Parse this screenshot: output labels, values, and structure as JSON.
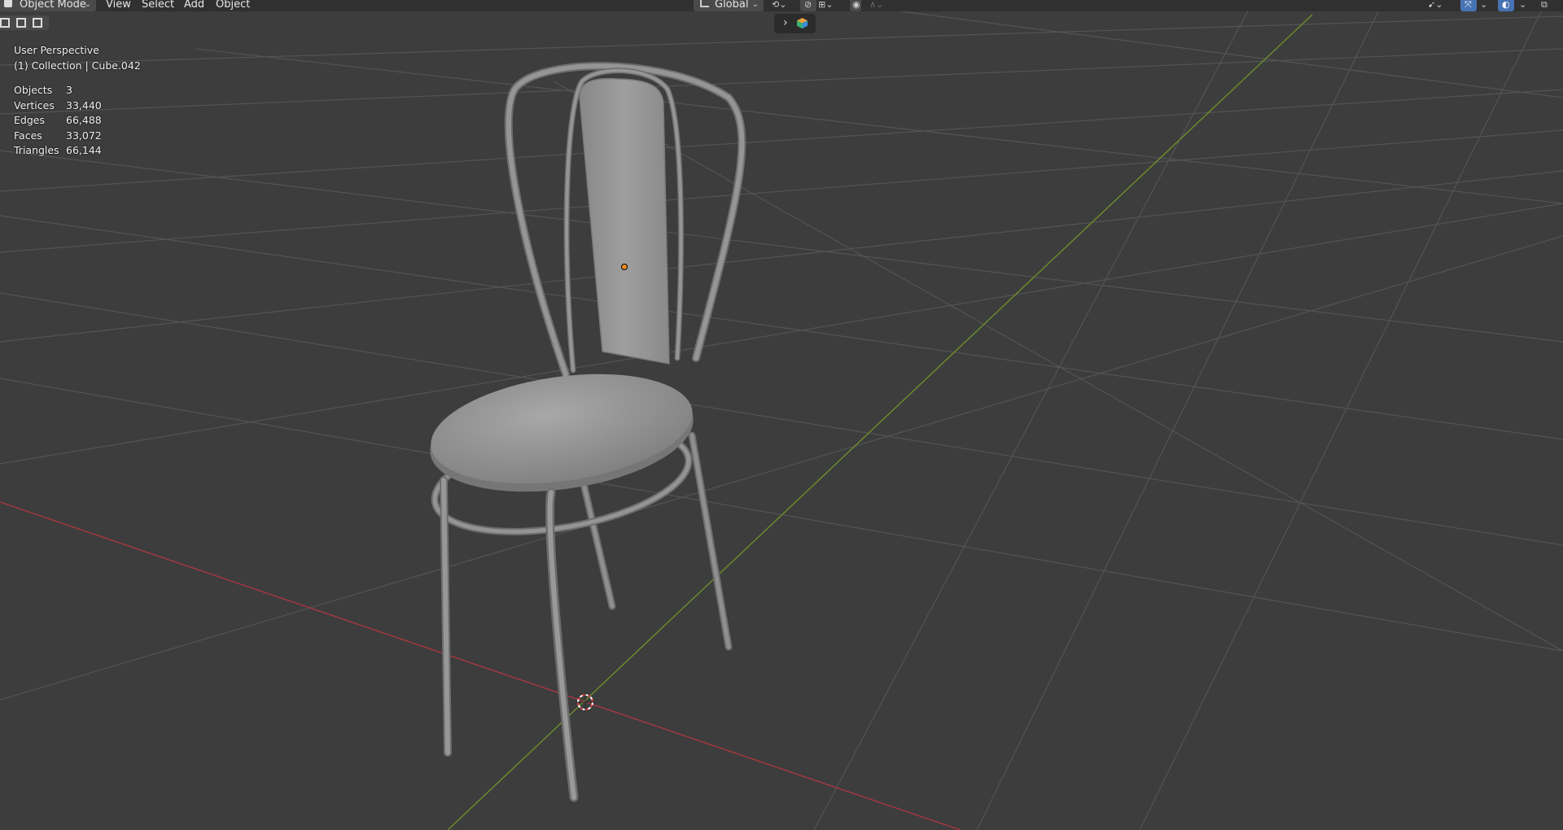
{
  "header": {
    "mode_select": "Object Mode",
    "menus": {
      "view": "View",
      "select": "Select",
      "add": "Add",
      "object": "Object"
    },
    "orientation": "Global",
    "icons": [
      "pivot-icon",
      "snap-icon",
      "proportional-edit-icon",
      "falloff-icon",
      "select-tool-icon",
      "gizmo-icon",
      "overlay-icon",
      "xray-icon"
    ]
  },
  "tool_header": {
    "icons": [
      "expand-chevron-icon",
      "scene-cube-icon"
    ]
  },
  "overlay": {
    "view_name": "User Perspective",
    "object_info": "(1) Collection | Cube.042"
  },
  "stats": [
    {
      "label": "Objects",
      "value": "3"
    },
    {
      "label": "Vertices",
      "value": "33,440"
    },
    {
      "label": "Edges",
      "value": "66,488"
    },
    {
      "label": "Faces",
      "value": "33,072"
    },
    {
      "label": "Triangles",
      "value": "66,144"
    }
  ],
  "colors": {
    "background": "#3d3d3d",
    "grid": "#545454",
    "x_axis": "#a8383f",
    "y_axis": "#6b8f2a",
    "chair": "#969696",
    "origin": "#f08a24"
  }
}
